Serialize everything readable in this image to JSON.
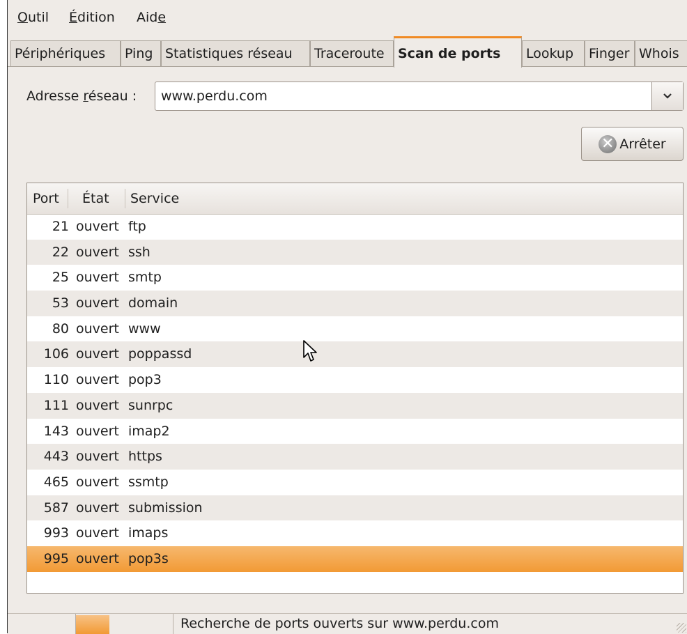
{
  "menubar": {
    "items": [
      {
        "pre": "",
        "u": "O",
        "post": "util"
      },
      {
        "pre": "",
        "u": "É",
        "post": "dition"
      },
      {
        "pre": "Aid",
        "u": "e",
        "post": ""
      }
    ]
  },
  "tabs": [
    {
      "label": "Périphériques",
      "active": false
    },
    {
      "label": "Ping",
      "active": false
    },
    {
      "label": "Statistiques réseau",
      "active": false
    },
    {
      "label": "Traceroute",
      "active": false
    },
    {
      "label": "Scan de ports",
      "active": true
    },
    {
      "label": "Lookup",
      "active": false
    },
    {
      "label": "Finger",
      "active": false
    },
    {
      "label": "Whois",
      "active": false
    }
  ],
  "address": {
    "label_pre": "Adresse ",
    "label_u": "r",
    "label_post": "éseau :",
    "value": "www.perdu.com",
    "dropdown_icon": "chevron-down-icon"
  },
  "stop_button": {
    "label": "Arrêter",
    "icon": "stop-icon"
  },
  "table": {
    "columns": [
      "Port",
      "État",
      "Service"
    ],
    "rows": [
      {
        "port": "21",
        "state": "ouvert",
        "service": "ftp"
      },
      {
        "port": "22",
        "state": "ouvert",
        "service": "ssh"
      },
      {
        "port": "25",
        "state": "ouvert",
        "service": "smtp"
      },
      {
        "port": "53",
        "state": "ouvert",
        "service": "domain"
      },
      {
        "port": "80",
        "state": "ouvert",
        "service": "www"
      },
      {
        "port": "106",
        "state": "ouvert",
        "service": "poppassd"
      },
      {
        "port": "110",
        "state": "ouvert",
        "service": "pop3"
      },
      {
        "port": "111",
        "state": "ouvert",
        "service": "sunrpc"
      },
      {
        "port": "143",
        "state": "ouvert",
        "service": "imap2"
      },
      {
        "port": "443",
        "state": "ouvert",
        "service": "https"
      },
      {
        "port": "465",
        "state": "ouvert",
        "service": "ssmtp"
      },
      {
        "port": "587",
        "state": "ouvert",
        "service": "submission"
      },
      {
        "port": "993",
        "state": "ouvert",
        "service": "imaps"
      },
      {
        "port": "995",
        "state": "ouvert",
        "service": "pop3s"
      }
    ],
    "selected_index": 13
  },
  "statusbar": {
    "text": "Recherche de ports ouverts sur www.perdu.com"
  },
  "colors": {
    "accent": "#f29a35",
    "window_bg": "#efebe7",
    "row_alt": "#ede9e5"
  }
}
